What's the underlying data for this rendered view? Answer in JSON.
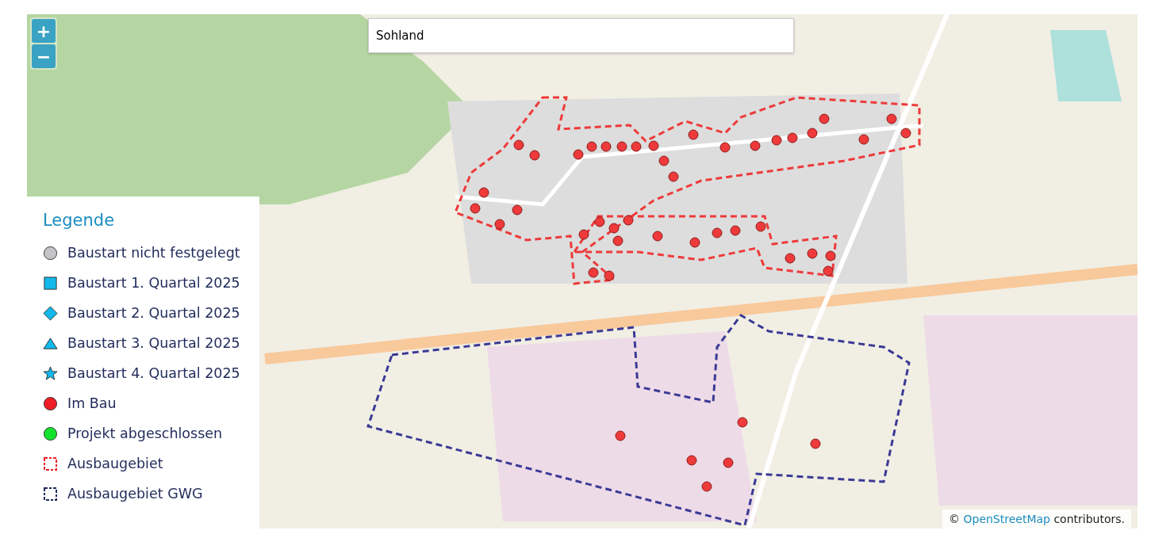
{
  "zoom_controls": [
    {
      "label": "+"
    },
    {
      "label": "−"
    }
  ],
  "search": {
    "value": "Sohland"
  },
  "legend": {
    "title": "Legende",
    "items": [
      {
        "kind": "circle",
        "color": "#c4c4c8",
        "label": "Baustart nicht festgelegt"
      },
      {
        "kind": "square",
        "color": "#12b8ea",
        "label": "Baustart 1. Quartal 2025"
      },
      {
        "kind": "diamond",
        "color": "#12b8ea",
        "label": "Baustart 2. Quartal 2025"
      },
      {
        "kind": "triangle",
        "color": "#12b8ea",
        "label": "Baustart 3. Quartal 2025"
      },
      {
        "kind": "star",
        "color": "#12b8ea",
        "label": "Baustart 4. Quartal 2025"
      },
      {
        "kind": "circle",
        "color": "#ee1c25",
        "label": "Im Bau"
      },
      {
        "kind": "circle",
        "color": "#13e22c",
        "label": "Projekt abgeschlossen"
      },
      {
        "kind": "area",
        "color": "#ee1c25",
        "label": "Ausbaugebiet"
      },
      {
        "kind": "area",
        "color": "#1f2a5a",
        "label": "Ausbaugebiet GWG"
      }
    ]
  },
  "attribution": {
    "prefix": "©",
    "link": "OpenStreetMap",
    "suffix": "contributors."
  }
}
